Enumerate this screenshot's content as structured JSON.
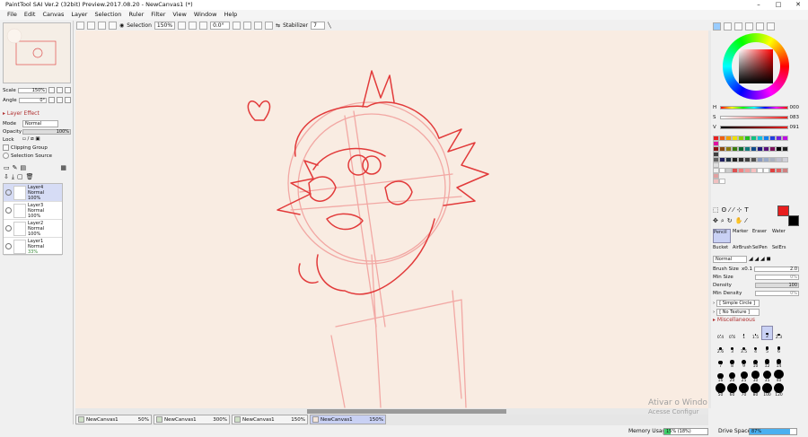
{
  "window": {
    "title": "PaintTool SAI Ver.2 (32bit) Preview.2017.08.20 - NewCanvas1 (*)",
    "controls": [
      "–",
      "□",
      "✕"
    ]
  },
  "menu": [
    "File",
    "Edit",
    "Canvas",
    "Layer",
    "Selection",
    "Ruler",
    "Filter",
    "View",
    "Window",
    "Help"
  ],
  "toolbar": {
    "selection_label": "Selection",
    "zoom": "150%",
    "angle": "0.0°",
    "stabilizer_label": "Stabilizer",
    "stabilizer_value": "7"
  },
  "navigator": {
    "scale_label": "Scale",
    "scale_value": "150%",
    "angle_label": "Angle",
    "angle_value": "0°"
  },
  "layer_effect": {
    "title": "Layer Effect",
    "mode_label": "Mode",
    "mode_value": "Normal",
    "opacity_label": "Opacity",
    "opacity_value": "100%",
    "lock_label": "Lock",
    "clipping_group": "Clipping Group",
    "selection_source": "Selection Source"
  },
  "layers": [
    {
      "name": "Layer4",
      "mode": "Normal",
      "opacity": "100%",
      "selected": true
    },
    {
      "name": "Layer3",
      "mode": "Normal",
      "opacity": "100%",
      "selected": false
    },
    {
      "name": "Layer2",
      "mode": "Normal",
      "opacity": "100%",
      "selected": false
    },
    {
      "name": "Layer1",
      "mode": "Normal",
      "opacity": "33%",
      "selected": false
    }
  ],
  "tabs": [
    {
      "name": "NewCanvas1",
      "zoom": "50%",
      "active": false
    },
    {
      "name": "NewCanvas1",
      "zoom": "300%",
      "active": false
    },
    {
      "name": "NewCanvas1",
      "zoom": "150%",
      "active": false
    },
    {
      "name": "NewCanvas1",
      "zoom": "150%",
      "active": true
    }
  ],
  "status": {
    "memory_label": "Memory Usage",
    "memory_value": "15% (18%)",
    "drive_label": "Drive Space",
    "drive_value": "87%"
  },
  "watermark": {
    "line1": "Ativar o Windo",
    "line2": "Acesse Configur"
  },
  "color": {
    "h_label": "H",
    "h_value": "000",
    "s_label": "S",
    "s_value": "083",
    "v_label": "V",
    "v_value": "091",
    "main": "#e81f1f",
    "sub": "#000000"
  },
  "tools": {
    "row1": [
      "Pencil",
      "Marker",
      "Eraser",
      "Water"
    ],
    "row2": [
      "Bucket",
      "AirBrush",
      "SelPen",
      "SelErs"
    ]
  },
  "brush": {
    "mode": "Normal",
    "size_label": "Brush Size",
    "size_mult": "x0.1",
    "size_value": "2.0",
    "min_size_label": "Min Size",
    "min_size_value": "0%",
    "density_label": "Density",
    "density_value": "100",
    "min_density_label": "Min Density",
    "min_density_value": "0%",
    "shape": "[ Simple Circle ]",
    "texture": "[ No Texture ]",
    "misc": "Miscellaneous"
  },
  "brush_sizes": [
    "0.4",
    "0.6",
    "1",
    "1.5",
    "2",
    "2.3",
    "2.6",
    "3",
    "3.5",
    "4",
    "5",
    "6",
    "7",
    "8",
    "9",
    "10",
    "12",
    "14",
    "16",
    "20",
    "25",
    "30",
    "35",
    "40",
    "50",
    "60",
    "70",
    "80",
    "100",
    "120"
  ],
  "accent": "#d43c3c"
}
